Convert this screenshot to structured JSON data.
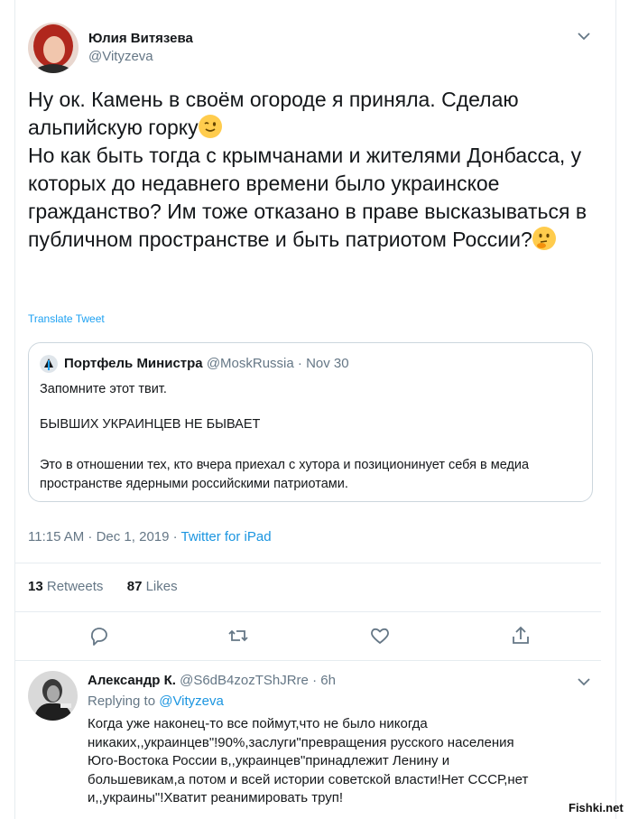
{
  "main_tweet": {
    "author_name": "Юлия Витязева",
    "author_handle": "@Vityzeva",
    "text_part1": "Ну ок. Камень в своём огороде я приняла. Сделаю альпийскую горку",
    "text_part2": "Но как быть тогда с крымчанами и жителями Донбасса, у которых до недавнего времени было украинское гражданство? Им тоже отказано в праве высказываться в публичном пространстве и быть патриотом России?",
    "translate_label": "Translate Tweet",
    "emoji_1": "winking-face-emoji",
    "emoji_2": "thinking-face-emoji"
  },
  "quoted_tweet": {
    "author_name": "Портфель Министра",
    "author_handle": "@MoskRussia",
    "separator": "·",
    "date": "Nov 30",
    "line1": "Запомните этот твит.",
    "line2": "БЫВШИХ УКРАИНЦЕВ НЕ БЫВАЕТ",
    "line3": "Это в отношении тех, кто вчера приехал с хутора и позиционинует себя в медиа пространстве ядерными российскими патриотами."
  },
  "meta": {
    "timestamp": "11:15 AM · Dec 1, 2019 · ",
    "source": "Twitter for iPad"
  },
  "stats": {
    "retweets_count": "13",
    "retweets_label": "Retweets",
    "likes_count": "87",
    "likes_label": "Likes"
  },
  "actions": [
    "reply-icon",
    "retweet-icon",
    "like-icon",
    "share-icon"
  ],
  "reply": {
    "author_name": "Александр К.",
    "author_handle": "@S6dB4zozTShJRre",
    "separator": "·",
    "time": "6h",
    "replying_label": "Replying to ",
    "replying_handle": "@Vityzeva",
    "text": "Когда уже наконец-то все поймут,что не было никогда\nникаких,,украинцев\"!90%,заслуги\"превращения русского населения\nЮго-Востока России в,,украинцев\"принадлежит Ленину и\nбольшевикам,а потом и всей истории советской власти!Нет СССР,нет\nи,,украины\"!Хватит реанимировать труп!"
  },
  "watermark": "Fishki.net",
  "colors": {
    "accent": "#1da1f2",
    "text": "#14171a",
    "muted": "#657786",
    "border": "#e6ecf0"
  }
}
